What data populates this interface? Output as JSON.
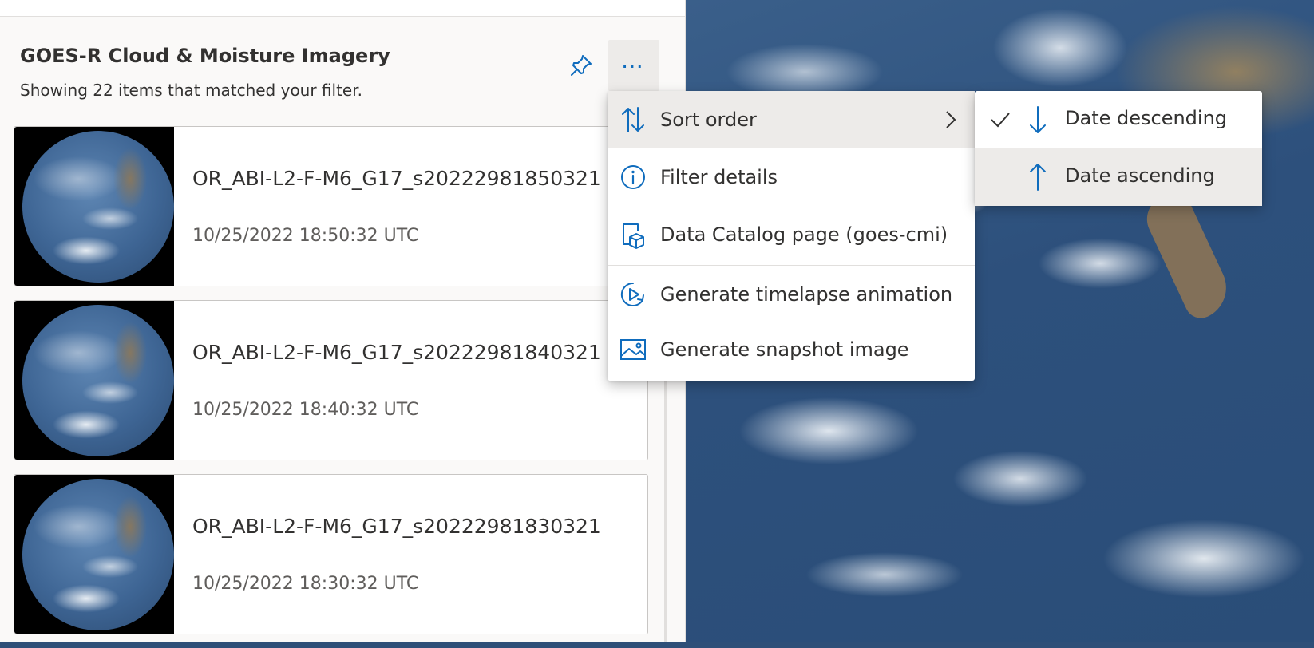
{
  "panel": {
    "title": "GOES-R Cloud & Moisture Imagery",
    "subtitle": "Showing 22 items that matched your filter.",
    "pin_icon": "pin-icon",
    "more_icon": "more-horizontal-icon",
    "more_label": "⋯"
  },
  "items": [
    {
      "title": "OR_ABI-L2-F-M6_G17_s20222981850321",
      "date": "10/25/2022 18:50:32 UTC"
    },
    {
      "title": "OR_ABI-L2-F-M6_G17_s20222981840321",
      "date": "10/25/2022 18:40:32 UTC"
    },
    {
      "title": "OR_ABI-L2-F-M6_G17_s20222981830321",
      "date": "10/25/2022 18:30:32 UTC"
    }
  ],
  "menu": {
    "items": [
      {
        "label": "Sort order",
        "icon": "sort-icon",
        "has_submenu": true
      },
      {
        "label": "Filter details",
        "icon": "info-icon"
      },
      {
        "label": "Data Catalog page (goes-cmi)",
        "icon": "catalog-icon"
      },
      {
        "label": "Generate timelapse animation",
        "icon": "timelapse-icon"
      },
      {
        "label": "Generate snapshot image",
        "icon": "image-icon"
      }
    ]
  },
  "submenu": {
    "items": [
      {
        "label": "Date descending",
        "checked": true,
        "icon": "arrow-down-icon"
      },
      {
        "label": "Date ascending",
        "checked": false,
        "icon": "arrow-up-icon"
      }
    ]
  },
  "colors": {
    "accent": "#0f6cbd",
    "text": "#323130",
    "highlight": "#edebe9"
  }
}
